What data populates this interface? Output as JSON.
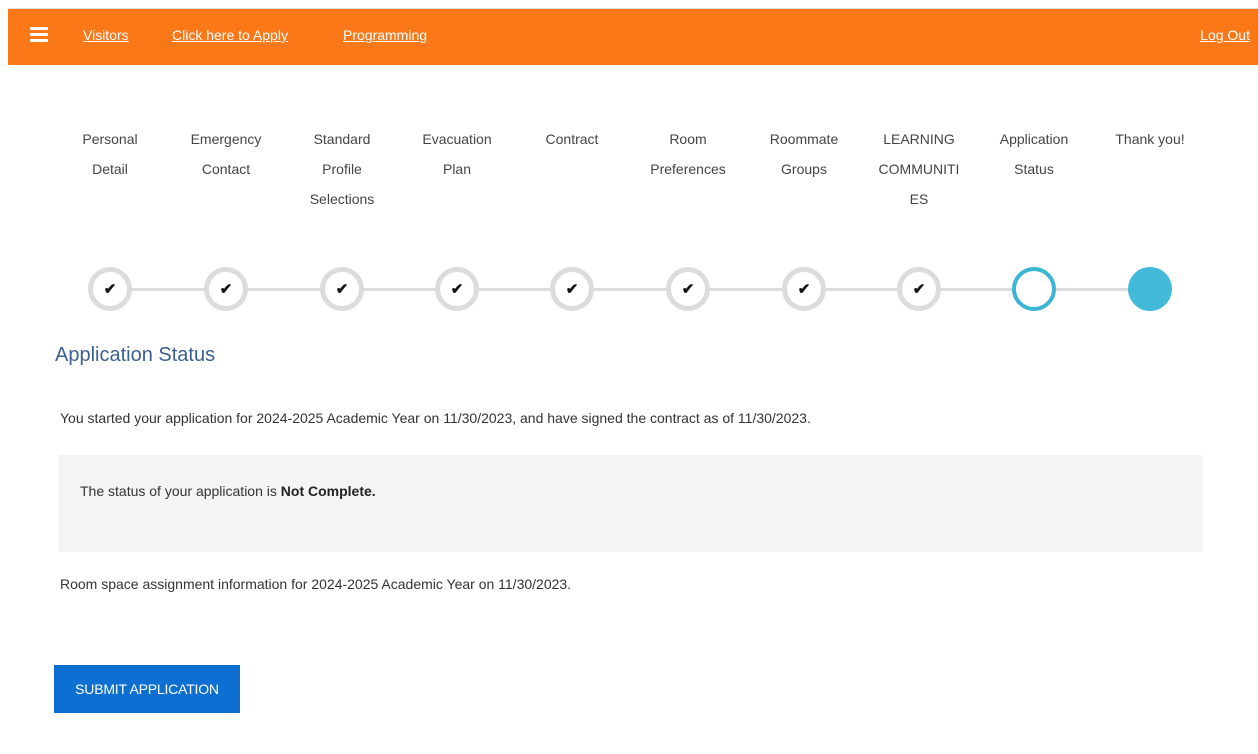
{
  "nav": {
    "links": [
      "Visitors",
      "Click here to Apply",
      "Programming"
    ],
    "logout": "Log Out"
  },
  "steps": [
    {
      "lines": [
        "Personal",
        "Detail"
      ],
      "state": "done",
      "check": "✔"
    },
    {
      "lines": [
        "Emergency",
        "Contact"
      ],
      "state": "done",
      "check": "✔"
    },
    {
      "lines": [
        "Standard",
        "Profile",
        "Selections"
      ],
      "state": "done",
      "check": "✔"
    },
    {
      "lines": [
        "Evacuation",
        "Plan"
      ],
      "state": "done",
      "check": "✔"
    },
    {
      "lines": [
        "Contract"
      ],
      "state": "done",
      "check": "✔"
    },
    {
      "lines": [
        "Room",
        "Preferences"
      ],
      "state": "done",
      "check": "✔"
    },
    {
      "lines": [
        "Roommate",
        "Groups"
      ],
      "state": "done",
      "check": "✔"
    },
    {
      "lines": [
        "LEARNING",
        "COMMUNITI",
        "ES"
      ],
      "state": "done",
      "check": "✔"
    },
    {
      "lines": [
        "Application",
        "Status"
      ],
      "state": "current",
      "check": ""
    },
    {
      "lines": [
        "Thank you!"
      ],
      "state": "future",
      "check": ""
    }
  ],
  "main": {
    "title": "Application Status",
    "intro": "You started your application for 2024-2025 Academic Year on 11/30/2023, and have signed the contract as of 11/30/2023.",
    "status_prefix": "The status of your application is ",
    "status_value": "Not Complete.",
    "room_info": "Room space assignment information for 2024-2025 Academic Year on 11/30/2023.",
    "submit_label": "SUBMIT APPLICATION"
  },
  "colors": {
    "topbar": "#fb7818",
    "step_done_border": "#dcdcdc",
    "step_current": "#3cb4d4",
    "step_future": "#43b9da",
    "title": "#3b5f8f",
    "button": "#0d6fd1"
  },
  "icons": {
    "menu": "hamburger-menu-icon",
    "done": "check-icon"
  }
}
